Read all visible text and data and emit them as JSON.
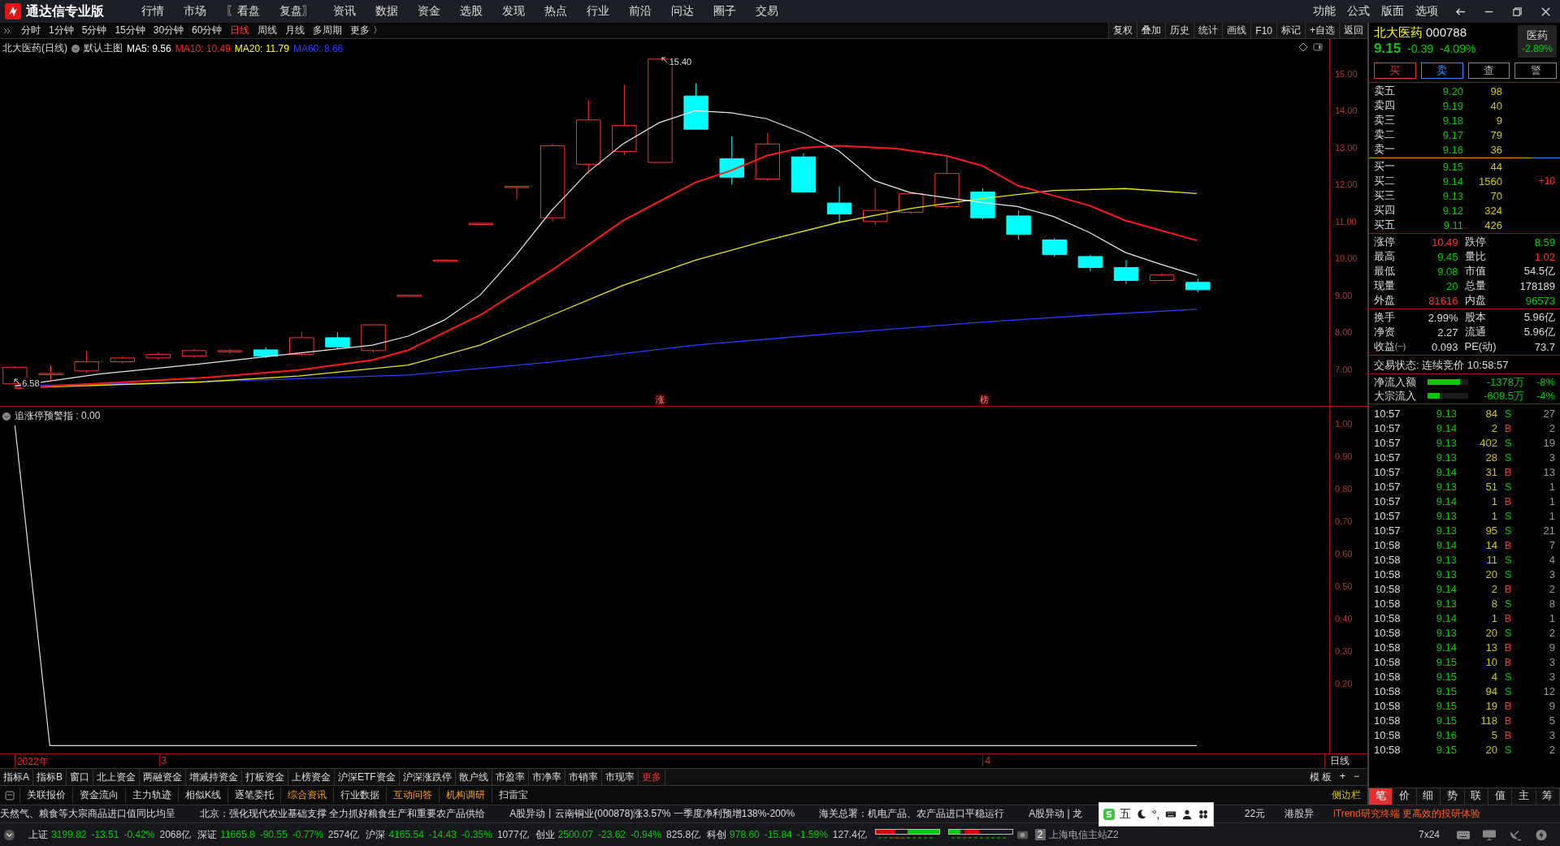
{
  "app": {
    "title": "通达信专业版"
  },
  "menu": [
    {
      "label": "行情"
    },
    {
      "label": "市场"
    },
    {
      "label": "〖看盘"
    },
    {
      "label": "复盘〗"
    },
    {
      "label": "资讯"
    },
    {
      "label": "数据"
    },
    {
      "label": "资金"
    },
    {
      "label": "选股"
    },
    {
      "label": "发现"
    },
    {
      "label": "热点"
    },
    {
      "label": "行业"
    },
    {
      "label": "前沿"
    },
    {
      "label": "问达"
    },
    {
      "label": "圈子"
    },
    {
      "label": "交易"
    }
  ],
  "menu_right": [
    "功能",
    "公式",
    "版面",
    "选项"
  ],
  "periods": [
    {
      "label": "分时",
      "selected": false
    },
    {
      "label": "1分钟",
      "selected": false
    },
    {
      "label": "5分钟",
      "selected": false
    },
    {
      "label": "15分钟",
      "selected": false
    },
    {
      "label": "30分钟",
      "selected": false
    },
    {
      "label": "60分钟",
      "selected": false
    },
    {
      "label": "日线",
      "selected": true
    },
    {
      "label": "周线",
      "selected": false
    },
    {
      "label": "月线",
      "selected": false
    },
    {
      "label": "多周期",
      "selected": false
    },
    {
      "label": "更多 〉",
      "selected": false
    }
  ],
  "chart_tools": [
    "复权",
    "叠加",
    "历史",
    "统计",
    "画线",
    "F10",
    "标记",
    "+自选",
    "返回"
  ],
  "chart": {
    "stock_label": "北大医药(日线)",
    "template": "默认主图",
    "mas": [
      {
        "text": "MA5: 9.56",
        "color": "#ffffff"
      },
      {
        "text": "MA10: 10.49",
        "color": "#ff2020"
      },
      {
        "text": "MA20: 11.79",
        "color": "#ffff00"
      },
      {
        "text": "MA60: 8.66",
        "color": "#2a3cff"
      }
    ],
    "high_label": "15.40",
    "low_label": "6.58",
    "markers": [
      "涨",
      "榜"
    ],
    "price_ticks": [
      "15.00",
      "14.00",
      "13.00",
      "12.00",
      "11.00",
      "10.00",
      "9.00",
      "8.00",
      "7.00"
    ]
  },
  "indicator": {
    "title": "追涨停预警指 : 0.00",
    "ticks": [
      "1.00",
      "0.90",
      "0.80",
      "0.70",
      "0.60",
      "0.50",
      "0.40",
      "0.30",
      "0.20"
    ]
  },
  "date_axis": {
    "labels": [
      "2022年",
      "3",
      "4"
    ],
    "period": "日线"
  },
  "bottom_tabs": [
    {
      "label": "指标A",
      "highlighted": false
    },
    {
      "label": "指标B",
      "highlighted": false
    },
    {
      "label": "窗口",
      "highlighted": false
    },
    {
      "label": "北上资金",
      "highlighted": false
    },
    {
      "label": "两融资金",
      "highlighted": false
    },
    {
      "label": "增减持资金",
      "highlighted": false
    },
    {
      "label": "打板资金",
      "highlighted": false
    },
    {
      "label": "上榜资金",
      "highlighted": false
    },
    {
      "label": "沪深ETF资金",
      "highlighted": false
    },
    {
      "label": "沪深涨跌停",
      "highlighted": false
    },
    {
      "label": "散户线",
      "highlighted": false
    },
    {
      "label": "市盈率",
      "highlighted": false
    },
    {
      "label": "市净率",
      "highlighted": false
    },
    {
      "label": "市销率",
      "highlighted": false
    },
    {
      "label": "市现率",
      "highlighted": false
    },
    {
      "label": "更多",
      "highlighted": true
    }
  ],
  "template_controls": [
    "模 板",
    "+",
    "−"
  ],
  "tool_tabs": [
    {
      "label": "关联报价",
      "highlighted": false
    },
    {
      "label": "资金流向",
      "highlighted": false
    },
    {
      "label": "主力轨迹",
      "highlighted": false
    },
    {
      "label": "相似K线",
      "highlighted": false
    },
    {
      "label": "逐笔委托",
      "highlighted": false
    },
    {
      "label": "综合资讯",
      "highlighted": true
    },
    {
      "label": "行业数据",
      "highlighted": false
    },
    {
      "label": "互动问答",
      "highlighted": true
    },
    {
      "label": "机构调研",
      "highlighted": true
    },
    {
      "label": "扫雷宝",
      "highlighted": false
    }
  ],
  "sidebar_toggle": "侧边栏",
  "quote": {
    "name": "北大医药",
    "code": "000788",
    "price": "9.15",
    "change": "-0.39",
    "change_pct": "-4.09%",
    "sector": "医药",
    "sector_pct": "-2.89%",
    "actions": [
      "买",
      "卖",
      "查",
      "警"
    ],
    "asks": [
      {
        "label": "卖五",
        "price": "9.20",
        "volume": "98"
      },
      {
        "label": "卖四",
        "price": "9.19",
        "volume": "40"
      },
      {
        "label": "卖三",
        "price": "9.18",
        "volume": "9"
      },
      {
        "label": "卖二",
        "price": "9.17",
        "volume": "79"
      },
      {
        "label": "卖一",
        "price": "9.16",
        "volume": "36"
      }
    ],
    "bids": [
      {
        "label": "买一",
        "price": "9.15",
        "volume": "44"
      },
      {
        "label": "买二",
        "price": "9.14",
        "volume": "1560",
        "delta": "+10"
      },
      {
        "label": "买三",
        "price": "9.13",
        "volume": "70"
      },
      {
        "label": "买四",
        "price": "9.12",
        "volume": "324"
      },
      {
        "label": "买五",
        "price": "9.11",
        "volume": "426"
      }
    ],
    "stats": [
      {
        "label": "涨停",
        "value": "10.49",
        "color": "#ff3232"
      },
      {
        "label": "跌停",
        "value": "8.59",
        "color": "#00cc00"
      },
      {
        "label": "最高",
        "value": "9.45",
        "color": "#00cc00"
      },
      {
        "label": "量比",
        "value": "1.02",
        "color": "#ff3232"
      },
      {
        "label": "最低",
        "value": "9.08",
        "color": "#00cc00"
      },
      {
        "label": "市值",
        "value": "54.5亿",
        "color": "#dddddd"
      },
      {
        "label": "现量",
        "value": "20",
        "color": "#00cc00"
      },
      {
        "label": "总量",
        "value": "178189",
        "color": "#dddddd"
      },
      {
        "label": "外盘",
        "value": "81616",
        "color": "#ff3232"
      },
      {
        "label": "内盘",
        "value": "96573",
        "color": "#00cc00"
      }
    ],
    "fundamentals": [
      {
        "label": "换手",
        "value": "2.99%"
      },
      {
        "label": "股本",
        "value": "5.96亿"
      },
      {
        "label": "净资",
        "value": "2.27"
      },
      {
        "label": "流通",
        "value": "5.96亿"
      },
      {
        "label": "收益㈠",
        "value": "0.093"
      },
      {
        "label": "PE(动)",
        "value": "73.7"
      }
    ],
    "status": "交易状态: 连续竞价 10:58:57",
    "flows": [
      {
        "label": "净流入额",
        "level": 0.8,
        "amount": "-1378万",
        "pct": "-8%"
      },
      {
        "label": "大宗流入",
        "level": 0.3,
        "amount": "-609.5万",
        "pct": "-4%"
      }
    ],
    "trades": [
      {
        "time": "10:57",
        "price": "9.13",
        "volume": "84",
        "side": "S",
        "count": "27"
      },
      {
        "time": "10:57",
        "price": "9.14",
        "volume": "2",
        "side": "B",
        "count": "2"
      },
      {
        "time": "10:57",
        "price": "9.13",
        "volume": "402",
        "side": "S",
        "count": "19"
      },
      {
        "time": "10:57",
        "price": "9.13",
        "volume": "28",
        "side": "S",
        "count": "3"
      },
      {
        "time": "10:57",
        "price": "9.14",
        "volume": "31",
        "side": "B",
        "count": "13"
      },
      {
        "time": "10:57",
        "price": "9.13",
        "volume": "51",
        "side": "S",
        "count": "1"
      },
      {
        "time": "10:57",
        "price": "9.14",
        "volume": "1",
        "side": "B",
        "count": "1"
      },
      {
        "time": "10:57",
        "price": "9.13",
        "volume": "1",
        "side": "S",
        "count": "1"
      },
      {
        "time": "10:57",
        "price": "9.13",
        "volume": "95",
        "side": "S",
        "count": "21"
      },
      {
        "time": "10:58",
        "price": "9.14",
        "volume": "14",
        "side": "B",
        "count": "7"
      },
      {
        "time": "10:58",
        "price": "9.13",
        "volume": "11",
        "side": "S",
        "count": "4"
      },
      {
        "time": "10:58",
        "price": "9.13",
        "volume": "20",
        "side": "S",
        "count": "3"
      },
      {
        "time": "10:58",
        "price": "9.14",
        "volume": "2",
        "side": "B",
        "count": "2"
      },
      {
        "time": "10:58",
        "price": "9.13",
        "volume": "8",
        "side": "S",
        "count": "8"
      },
      {
        "time": "10:58",
        "price": "9.14",
        "volume": "1",
        "side": "B",
        "count": "1"
      },
      {
        "time": "10:58",
        "price": "9.13",
        "volume": "20",
        "side": "S",
        "count": "2"
      },
      {
        "time": "10:58",
        "price": "9.14",
        "volume": "13",
        "side": "B",
        "count": "9"
      },
      {
        "time": "10:58",
        "price": "9.15",
        "volume": "10",
        "side": "B",
        "count": "3"
      },
      {
        "time": "10:58",
        "price": "9.15",
        "volume": "4",
        "side": "S",
        "count": "3"
      },
      {
        "time": "10:58",
        "price": "9.15",
        "volume": "94",
        "side": "S",
        "count": "12"
      },
      {
        "time": "10:58",
        "price": "9.15",
        "volume": "19",
        "side": "B",
        "count": "9"
      },
      {
        "time": "10:58",
        "price": "9.15",
        "volume": "118",
        "side": "B",
        "count": "5"
      },
      {
        "time": "10:58",
        "price": "9.16",
        "volume": "5",
        "side": "B",
        "count": "3"
      },
      {
        "time": "10:58",
        "price": "9.15",
        "volume": "20",
        "side": "S",
        "count": "2"
      }
    ],
    "panel_tabs": [
      {
        "label": "笔",
        "selected": true
      },
      {
        "label": "价",
        "selected": false
      },
      {
        "label": "细",
        "selected": false
      },
      {
        "label": "势",
        "selected": false
      },
      {
        "label": "联",
        "selected": false
      },
      {
        "label": "值",
        "selected": false
      },
      {
        "label": "主",
        "selected": false
      },
      {
        "label": "筹",
        "selected": false
      }
    ]
  },
  "ticker": [
    {
      "text": "天然气、粮食等大宗商品进口值同比均呈",
      "highlighted": false
    },
    {
      "text": "北京：强化现代农业基础支撑 全力抓好粮食生产和重要农产品供给",
      "highlighted": false
    },
    {
      "text": "A股异动丨云南铜业(000878)涨3.57% 一季度净利预增138%-200%",
      "highlighted": false
    },
    {
      "text": "海关总署：机电产品、农产品进口平稳运行",
      "highlighted": false
    },
    {
      "text": "A股异动 | 龙",
      "highlighted": false
    },
    {
      "text": "22元",
      "highlighted": false
    },
    {
      "text": "港股异",
      "highlighted": false
    },
    {
      "text": "iTrend研究终端 更高效的投研体验",
      "highlighted": true
    }
  ],
  "ime_toolbar": {
    "mode": "五",
    "punctuation": "°,"
  },
  "indices": [
    {
      "name": "上证",
      "price": "3199.82",
      "change": "-13.51",
      "pct": "-0.42%",
      "turnover": "2068亿"
    },
    {
      "name": "深证",
      "price": "11665.8",
      "change": "-90.55",
      "pct": "-0.77%",
      "turnover": "2574亿"
    },
    {
      "name": "沪深",
      "price": "4165.54",
      "change": "-14.43",
      "pct": "-0.35%",
      "turnover": "1077亿"
    },
    {
      "name": "创业",
      "price": "2500.07",
      "change": "-23.62",
      "pct": "-0.94%",
      "turnover": "825.8亿"
    },
    {
      "name": "科创",
      "price": "978.60",
      "change": "-15.84",
      "pct": "-1.59%",
      "turnover": "127.4亿"
    }
  ],
  "connection": {
    "badge": "2",
    "server": "上海电信主站Z2",
    "news_mode": "7x24"
  }
}
